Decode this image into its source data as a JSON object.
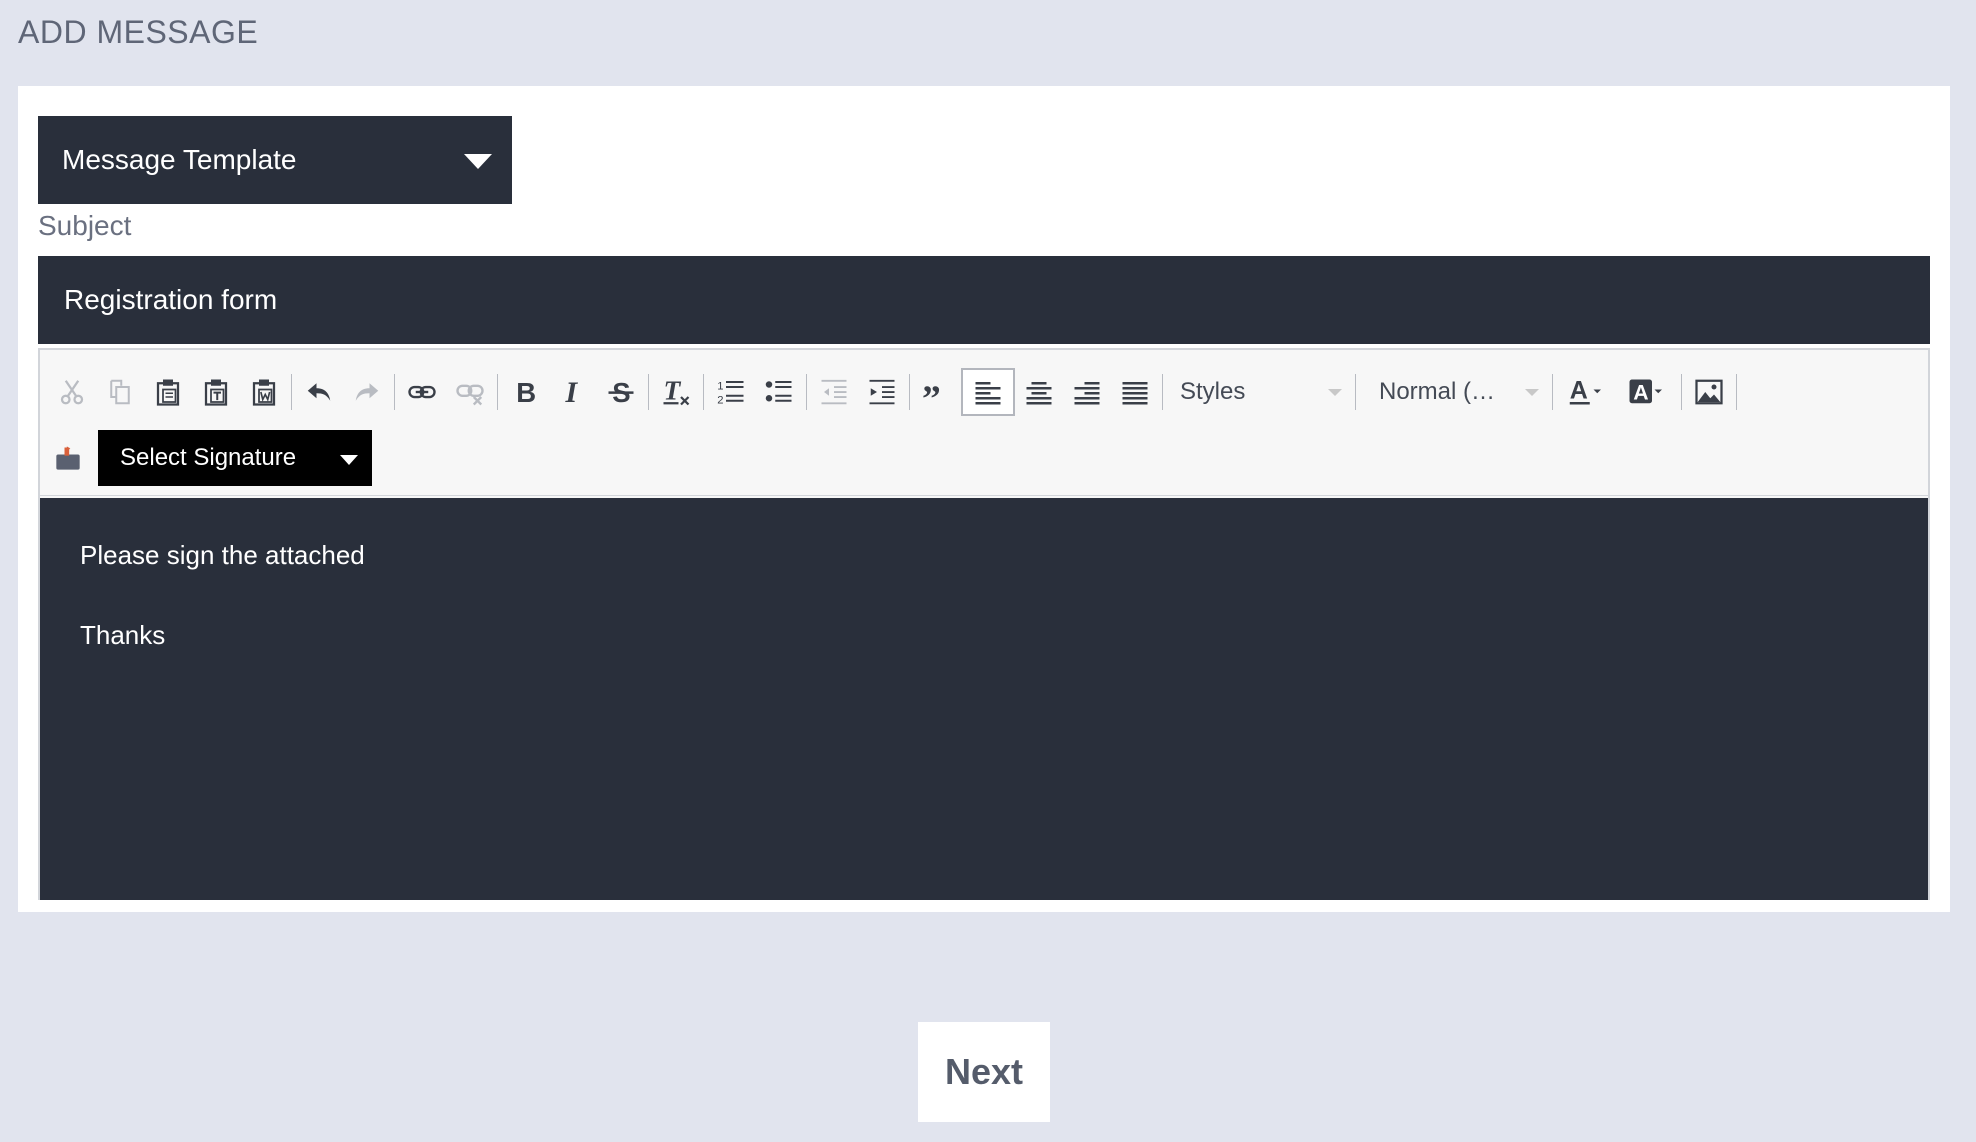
{
  "page": {
    "title": "ADD MESSAGE"
  },
  "template_select": {
    "value": "Message Template"
  },
  "subject": {
    "label": "Subject",
    "value": "Registration form"
  },
  "toolbar": {
    "styles_label": "Styles",
    "format_label": "Normal (…",
    "signature_label": "Select Signature"
  },
  "editor": {
    "paragraphs": [
      "Please sign the attached",
      "Thanks"
    ]
  },
  "actions": {
    "next_label": "Next"
  },
  "colors": {
    "background": "#e1e4ee",
    "dark_field": "#292f3b",
    "signature_bg": "#000000",
    "icon_enabled": "#3a3f48",
    "icon_disabled": "#b9bcc2"
  }
}
